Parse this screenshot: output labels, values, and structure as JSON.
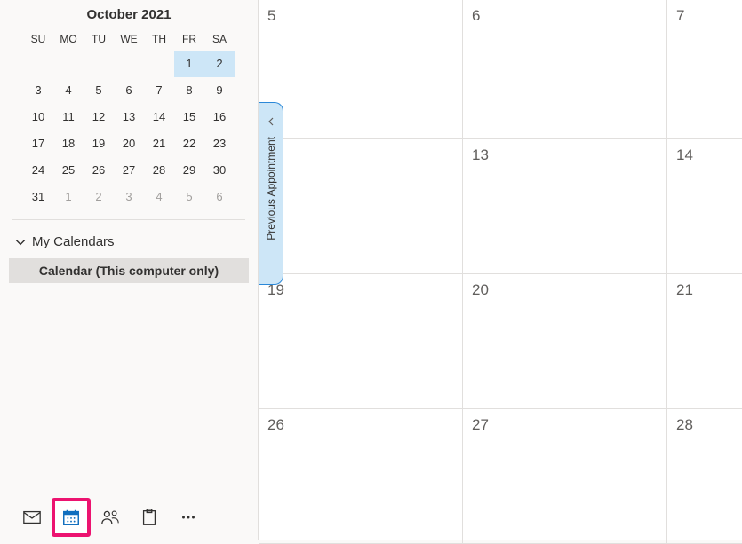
{
  "miniCalendar": {
    "title": "October 2021",
    "dow": [
      "SU",
      "MO",
      "TU",
      "WE",
      "TH",
      "FR",
      "SA"
    ],
    "cells": [
      {
        "d": "",
        "muted": true,
        "hl": false
      },
      {
        "d": "",
        "muted": true,
        "hl": false
      },
      {
        "d": "",
        "muted": true,
        "hl": false
      },
      {
        "d": "",
        "muted": true,
        "hl": false
      },
      {
        "d": "",
        "muted": true,
        "hl": false
      },
      {
        "d": "1",
        "muted": false,
        "hl": true
      },
      {
        "d": "2",
        "muted": false,
        "hl": true
      },
      {
        "d": "3",
        "muted": false,
        "hl": false
      },
      {
        "d": "4",
        "muted": false,
        "hl": false
      },
      {
        "d": "5",
        "muted": false,
        "hl": false
      },
      {
        "d": "6",
        "muted": false,
        "hl": false
      },
      {
        "d": "7",
        "muted": false,
        "hl": false
      },
      {
        "d": "8",
        "muted": false,
        "hl": false
      },
      {
        "d": "9",
        "muted": false,
        "hl": false
      },
      {
        "d": "10",
        "muted": false,
        "hl": false
      },
      {
        "d": "11",
        "muted": false,
        "hl": false
      },
      {
        "d": "12",
        "muted": false,
        "hl": false
      },
      {
        "d": "13",
        "muted": false,
        "hl": false
      },
      {
        "d": "14",
        "muted": false,
        "hl": false
      },
      {
        "d": "15",
        "muted": false,
        "hl": false
      },
      {
        "d": "16",
        "muted": false,
        "hl": false
      },
      {
        "d": "17",
        "muted": false,
        "hl": false
      },
      {
        "d": "18",
        "muted": false,
        "hl": false
      },
      {
        "d": "19",
        "muted": false,
        "hl": false
      },
      {
        "d": "20",
        "muted": false,
        "hl": false
      },
      {
        "d": "21",
        "muted": false,
        "hl": false
      },
      {
        "d": "22",
        "muted": false,
        "hl": false
      },
      {
        "d": "23",
        "muted": false,
        "hl": false
      },
      {
        "d": "24",
        "muted": false,
        "hl": false
      },
      {
        "d": "25",
        "muted": false,
        "hl": false
      },
      {
        "d": "26",
        "muted": false,
        "hl": false
      },
      {
        "d": "27",
        "muted": false,
        "hl": false
      },
      {
        "d": "28",
        "muted": false,
        "hl": false
      },
      {
        "d": "29",
        "muted": false,
        "hl": false
      },
      {
        "d": "30",
        "muted": false,
        "hl": false
      },
      {
        "d": "31",
        "muted": false,
        "hl": false
      },
      {
        "d": "1",
        "muted": true,
        "hl": false
      },
      {
        "d": "2",
        "muted": true,
        "hl": false
      },
      {
        "d": "3",
        "muted": true,
        "hl": false
      },
      {
        "d": "4",
        "muted": true,
        "hl": false
      },
      {
        "d": "5",
        "muted": true,
        "hl": false
      },
      {
        "d": "6",
        "muted": true,
        "hl": false
      }
    ]
  },
  "calGroupLabel": "My Calendars",
  "calItemLabel": "Calendar (This computer only)",
  "prevAppointment": "Previous Appointment",
  "mainGrid": [
    [
      "5",
      "6",
      "7"
    ],
    [
      "",
      "13",
      "14"
    ],
    [
      "19",
      "20",
      "21"
    ],
    [
      "26",
      "27",
      "28"
    ]
  ]
}
